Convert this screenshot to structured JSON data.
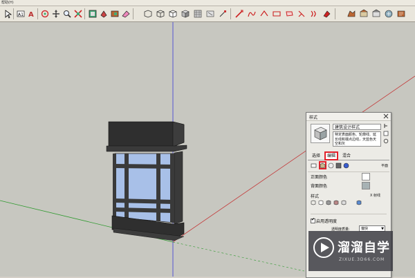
{
  "menubar": {
    "help_label": "帮助(H)"
  },
  "toolbar": {
    "icons": [
      "select-arrow-icon",
      "text-icon",
      "3d-text-icon",
      "orbit-icon",
      "pan-icon",
      "zoom-icon",
      "zoom-extents-icon",
      "components-icon",
      "paint-icon",
      "materials-icon",
      "eraser-icon",
      "xray-icon",
      "wireframe-icon",
      "hidden-line-icon",
      "shaded-icon",
      "textured-icon",
      "monochrome-icon",
      "line-icon",
      "arc-icon",
      "freehand-icon",
      "rectangle-icon",
      "circle-icon",
      "polygon-icon",
      "offset-icon",
      "pushpull-icon",
      "followme-icon",
      "move-icon",
      "rotate-icon",
      "scale-icon"
    ]
  },
  "styles_panel": {
    "title": "样式",
    "style_name": "建筑设计样式",
    "description": "特定表面颜色、轮廓线、延长线和端点边线，天蓝色天空和灰",
    "tabs": {
      "select": "选择",
      "edit": "编辑",
      "mix": "混合"
    },
    "view_mode_label": "平面",
    "front_color_label": "正面颜色",
    "back_color_label": "背面颜色",
    "style_label": "样式",
    "xray_label": "X 射线",
    "enable_transparency_label": "启用透明度",
    "transparency_quality_label": "透明度质量:",
    "transparency_quality_value": "偏快",
    "colors": {
      "front": "#ffffff",
      "back": "#a7b2b4"
    }
  },
  "watermark": {
    "title": "溜溜自学",
    "url": "ZIXUE.3D66.COM"
  },
  "colors": {
    "highlight": "#e2212b",
    "glass": "#a8c0e8",
    "frame": "#3a3a3a"
  }
}
